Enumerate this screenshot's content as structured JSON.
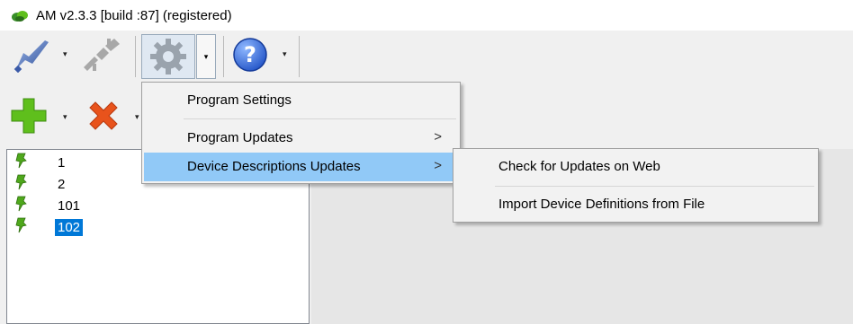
{
  "window": {
    "title": "AM v2.3.3 [build :87] (registered)",
    "icon": "leaf-logo-icon"
  },
  "toolbar": {
    "buttons": [
      {
        "name": "connect-button",
        "icon": "plug-icon"
      },
      {
        "name": "disconnect-button",
        "icon": "unplug-icon"
      },
      {
        "name": "settings-button",
        "icon": "gear-icon"
      },
      {
        "name": "help-button",
        "icon": "help-icon"
      }
    ],
    "dropdown_arrow": "▾"
  },
  "toolbar2": {
    "buttons": [
      {
        "name": "add-button",
        "icon": "plus-icon",
        "color": "#5fbf1c"
      },
      {
        "name": "remove-button",
        "icon": "x-icon",
        "color": "#e8531c"
      }
    ]
  },
  "device_list": {
    "items": [
      {
        "label": "1",
        "selected": false
      },
      {
        "label": "2",
        "selected": false
      },
      {
        "label": "101",
        "selected": false
      },
      {
        "label": "102",
        "selected": true
      }
    ],
    "item_icon": "pushpin-icon"
  },
  "settings_menu": {
    "items": [
      {
        "label": "Program Settings",
        "has_submenu": false
      },
      {
        "label": "Program Updates",
        "has_submenu": true,
        "arrow": ">"
      },
      {
        "label": "Device Descriptions Updates",
        "has_submenu": true,
        "arrow": ">",
        "highlighted": true
      }
    ]
  },
  "device_updates_submenu": {
    "items": [
      {
        "label": "Check for Updates on Web"
      },
      {
        "label": "Import Device Definitions from File"
      }
    ]
  },
  "colors": {
    "highlight": "#91c9f7",
    "selection": "#0078d7",
    "accent_orange": "#e8531c",
    "accent_green": "#5fbf1c"
  }
}
